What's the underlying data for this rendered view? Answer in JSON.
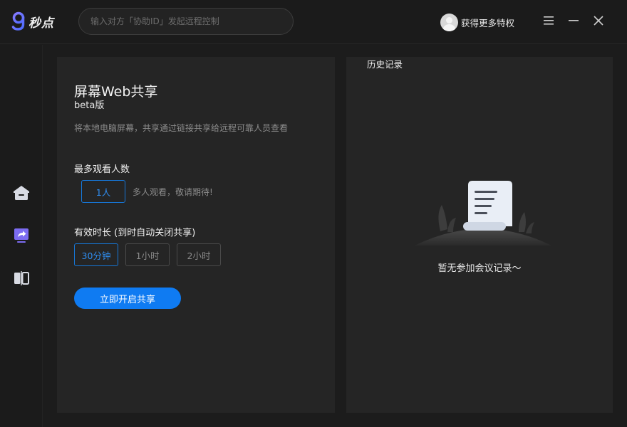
{
  "app": {
    "name": "秒点"
  },
  "search": {
    "placeholder": "输入对方「协助ID」发起远程控制"
  },
  "user": {
    "upgrade_label": "获得更多特权"
  },
  "window_controls": [
    "menu-icon",
    "minimize-icon",
    "close-icon"
  ],
  "sidebar": {
    "items": [
      {
        "icon": "home-icon",
        "active": false
      },
      {
        "icon": "screen-share-icon",
        "active": true
      },
      {
        "icon": "split-view-icon",
        "active": false
      }
    ]
  },
  "share": {
    "title": "屏幕Web共享",
    "subtitle": "beta版",
    "description": "将本地电脑屏幕，共享通过链接共享给远程可靠人员查看",
    "viewers_label": "最多观看人数",
    "viewers_option": "1人",
    "viewers_hint": "多人观看，敬请期待!",
    "duration_label": "有效时长 (到时自动关闭共享)",
    "duration_options": [
      "30分钟",
      "1小时",
      "2小时"
    ],
    "duration_selected": "30分钟",
    "start_button": "立即开启共享"
  },
  "history": {
    "title": "历史记录",
    "empty_text": "暂无参加会议记录～"
  },
  "colors": {
    "accent": "#0f7bf2",
    "background": "#1c1c1c",
    "panel": "#252525",
    "nav_active": "#7c6cf2"
  }
}
